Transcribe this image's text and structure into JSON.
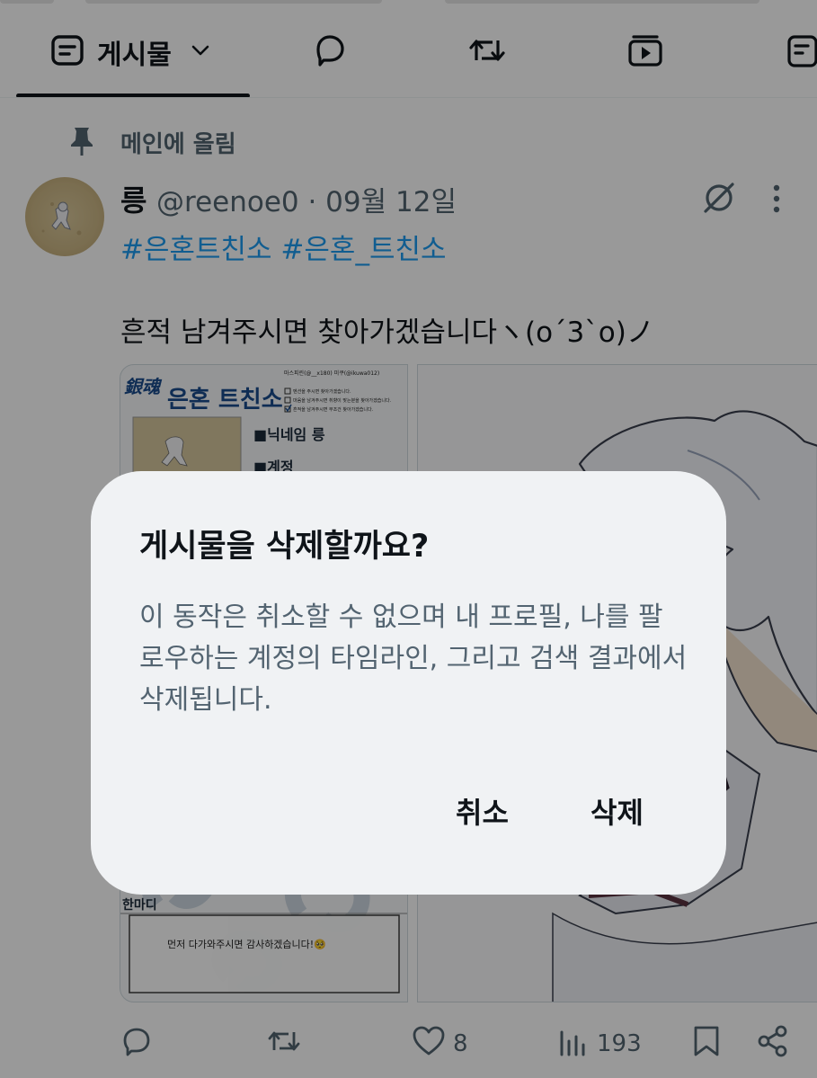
{
  "tabs": {
    "active_label": "게시물"
  },
  "pinned": {
    "label": "메인에 올림"
  },
  "post": {
    "author_name": "릉",
    "handle_date": "@reenoe0 · 09월 12일",
    "hashtags": "#은혼트친소 #은혼_트친소",
    "body": "흔적 남겨주시면 찾아가겠습니다ヽ(o´3`o)ノ",
    "card": {
      "logo_text": "銀魂",
      "title": "은혼 트친소",
      "header_line": "마스피린(@__x180) 미쿠(@ikuwa012)",
      "checklist": [
        "멘션을 주시면 찾아가겠습니다.",
        "마음을 남겨주시면 취향이 맞는분을 찾아가겠습니다.",
        "흔적을 남겨주시면 무조건 찾아가겠습니다."
      ],
      "nickname_label": "■닉네임 릉",
      "account_label": "■계정",
      "oneliner_label": "한마디",
      "oneliner_text": "먼저 다가와주시면 감사하겠습니다!🥺"
    },
    "stats": {
      "likes": "8",
      "views": "193"
    }
  },
  "dialog": {
    "title": "게시물을 삭제할까요?",
    "message": "이 동작은 취소할 수 없으며 내 프로필, 나를 팔로우하는 계정의 타임라인, 그리고 검색 결과에서 삭제됩니다.",
    "cancel_label": "취소",
    "delete_label": "삭제"
  }
}
